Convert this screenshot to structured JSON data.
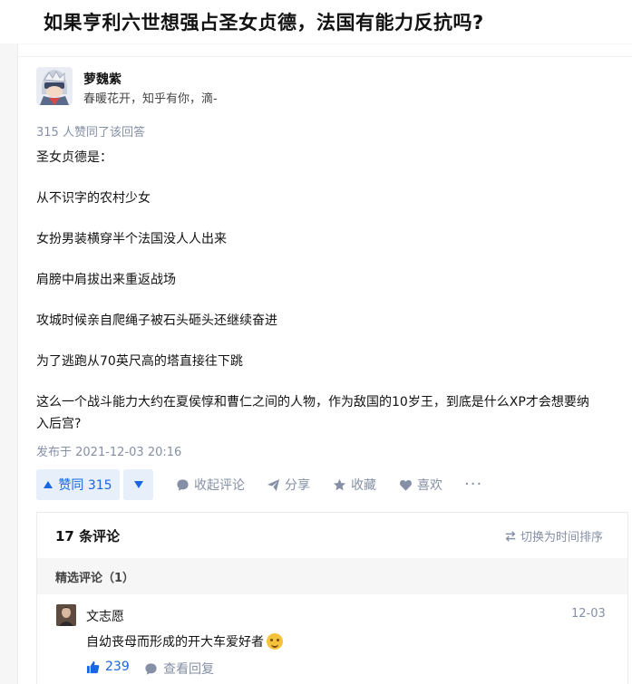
{
  "question": {
    "title": "如果亨利六世想强占圣女贞德，法国有能力反抗吗?"
  },
  "author": {
    "name": "萝魏紫",
    "bio": "春暖花开，知乎有你，滴-"
  },
  "answer": {
    "votes_line": "315 人赞同了该回答",
    "paragraphs": [
      "圣女贞德是：",
      "从不识字的农村少女",
      "女扮男装横穿半个法国没人人出来",
      "肩膀中肩拔出来重返战场",
      "攻城时候亲自爬绳子被石头砸头还继续奋进",
      "为了逃跑从70英尺高的塔直接往下跳",
      "这么一个战斗能力大约在夏侯惇和曹仁之间的人物，作为敌国的10岁王，到底是什么XP才会想要纳",
      "入后宫?"
    ],
    "publish_time": "发布于 2021-12-03 20:16"
  },
  "actions": {
    "upvote_label": "赞同 315",
    "collapse_comments": "收起评论",
    "share": "分享",
    "favorite": "收藏",
    "like": "喜欢",
    "more": "···"
  },
  "comments": {
    "count_label": "17 条评论",
    "sort_label": "切换为时间排序",
    "featured_label": "精选评论（1）",
    "items": [
      {
        "user": "文志愿",
        "date": "12-03",
        "text": "自幼丧母而形成的开大车爱好者",
        "emoji": "grinning-face-emoji",
        "likes": "239",
        "reply_label": "查看回复"
      }
    ]
  },
  "colors": {
    "accent": "#1966e3",
    "muted": "#8590a6",
    "vote_bg": "#e7effb"
  }
}
